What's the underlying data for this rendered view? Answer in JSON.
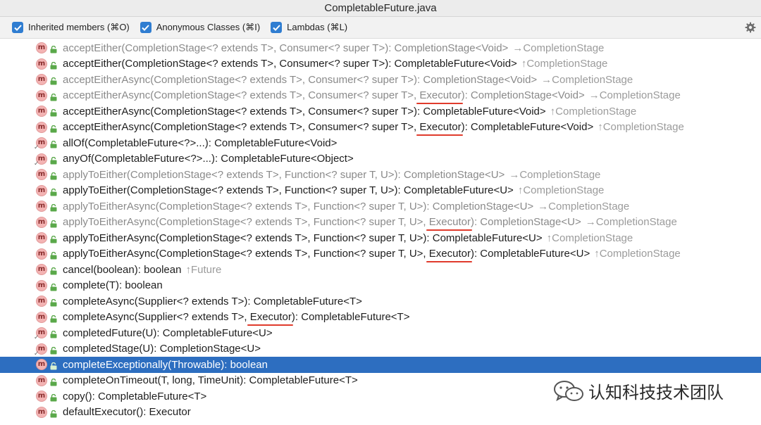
{
  "window": {
    "title": "CompletableFuture.java"
  },
  "filters": [
    {
      "label": "Inherited members (⌘O)",
      "checked": true
    },
    {
      "label": "Anonymous Classes (⌘I)",
      "checked": true
    },
    {
      "label": "Lambdas (⌘L)",
      "checked": true
    }
  ],
  "icons": {
    "settings": "gear-icon",
    "method": "method-badge-icon",
    "visibility": "public-lock-icon"
  },
  "colors": {
    "selection": "#2d6ec0",
    "underline": "#e03b2c",
    "checkbox": "#2f7dd1",
    "method_badge": "#f3b3b3"
  },
  "members": [
    {
      "pre": "acceptEither(CompletionStage<? extends T>, Consumer<? super T>): CompletionStage<Void>",
      "via": "→CompletionStage",
      "inherited": true,
      "static": false
    },
    {
      "pre": "acceptEither(CompletionStage<? extends T>, Consumer<? super T>): CompletableFuture<Void>",
      "via": "↑CompletionStage",
      "inherited": false,
      "static": false
    },
    {
      "pre": "acceptEitherAsync(CompletionStage<? extends T>, Consumer<? super T>): CompletionStage<Void>",
      "via": "→CompletionStage",
      "inherited": true,
      "static": false
    },
    {
      "pre": "acceptEitherAsync(CompletionStage<? extends T>, Consumer<? super T>, ",
      "exec": "Executor",
      "post": "): CompletionStage<Void>",
      "via": "→CompletionStage",
      "inherited": true,
      "static": false
    },
    {
      "pre": "acceptEitherAsync(CompletionStage<? extends T>, Consumer<? super T>): CompletableFuture<Void>",
      "via": "↑CompletionStage",
      "inherited": false,
      "static": false
    },
    {
      "pre": "acceptEitherAsync(CompletionStage<? extends T>, Consumer<? super T>, ",
      "exec": "Executor",
      "post": "): CompletableFuture<Void>",
      "via": "↑CompletionStage",
      "inherited": false,
      "static": false
    },
    {
      "pre": "allOf(CompletableFuture<?>...): CompletableFuture<Void>",
      "via": "",
      "inherited": false,
      "static": true
    },
    {
      "pre": "anyOf(CompletableFuture<?>...): CompletableFuture<Object>",
      "via": "",
      "inherited": false,
      "static": true
    },
    {
      "pre": "applyToEither(CompletionStage<? extends T>, Function<? super T, U>): CompletionStage<U>",
      "via": "→CompletionStage",
      "inherited": true,
      "static": false
    },
    {
      "pre": "applyToEither(CompletionStage<? extends T>, Function<? super T, U>): CompletableFuture<U>",
      "via": "↑CompletionStage",
      "inherited": false,
      "static": false
    },
    {
      "pre": "applyToEitherAsync(CompletionStage<? extends T>, Function<? super T, U>): CompletionStage<U>",
      "via": "→CompletionStage",
      "inherited": true,
      "static": false
    },
    {
      "pre": "applyToEitherAsync(CompletionStage<? extends T>, Function<? super T, U>, ",
      "exec": "Executor",
      "post": "): CompletionStage<U>",
      "via": "→CompletionStage",
      "inherited": true,
      "static": false
    },
    {
      "pre": "applyToEitherAsync(CompletionStage<? extends T>, Function<? super T, U>): CompletableFuture<U>",
      "via": "↑CompletionStage",
      "inherited": false,
      "static": false
    },
    {
      "pre": "applyToEitherAsync(CompletionStage<? extends T>, Function<? super T, U>, ",
      "exec": "Executor",
      "post": "): CompletableFuture<U>",
      "via": "↑CompletionStage",
      "inherited": false,
      "static": false
    },
    {
      "pre": "cancel(boolean): boolean",
      "via": "↑Future",
      "inherited": false,
      "static": false
    },
    {
      "pre": "complete(T): boolean",
      "via": "",
      "inherited": false,
      "static": false
    },
    {
      "pre": "completeAsync(Supplier<? extends T>): CompletableFuture<T>",
      "via": "",
      "inherited": false,
      "static": false
    },
    {
      "pre": "completeAsync(Supplier<? extends T>, ",
      "exec": "Executor",
      "post": "): CompletableFuture<T>",
      "via": "",
      "inherited": false,
      "static": false
    },
    {
      "pre": "completedFuture(U): CompletableFuture<U>",
      "via": "",
      "inherited": false,
      "static": true
    },
    {
      "pre": "completedStage(U): CompletionStage<U>",
      "via": "",
      "inherited": false,
      "static": true
    },
    {
      "pre": "completeExceptionally(Throwable): boolean",
      "via": "",
      "inherited": false,
      "static": false,
      "selected": true
    },
    {
      "pre": "completeOnTimeout(T, long, TimeUnit): CompletableFuture<T>",
      "via": "",
      "inherited": false,
      "static": false
    },
    {
      "pre": "copy(): CompletableFuture<T>",
      "via": "",
      "inherited": false,
      "static": false
    },
    {
      "pre": "defaultExecutor(): Executor",
      "via": "",
      "inherited": false,
      "static": false
    }
  ],
  "watermark": {
    "text": "认知科技技术团队",
    "icon": "wechat-icon"
  }
}
